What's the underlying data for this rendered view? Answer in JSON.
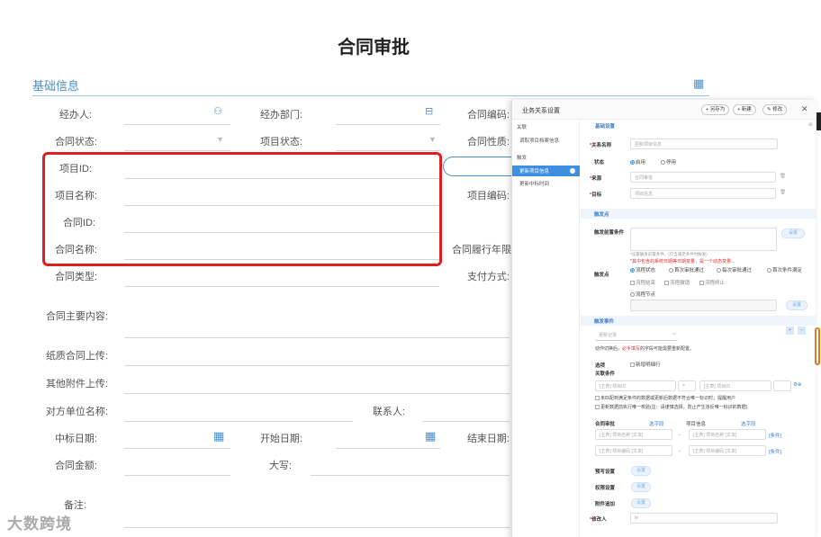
{
  "form": {
    "title": "合同审批",
    "section": "基础信息",
    "labels": {
      "handler": "经办人:",
      "dept": "经办部门:",
      "contract_code": "合同编码:",
      "contract_status": "合同状态:",
      "project_status": "项目状态:",
      "contract_nature": "合同性质:",
      "project_id": "项目ID:",
      "project_name": "项目名称:",
      "project_code": "项目编码:",
      "contract_id": "合同ID:",
      "contract_name": "合同名称:",
      "contract_years": "合同履行年限",
      "contract_type": "合同类型:",
      "payment": "支付方式:",
      "main_content": "合同主要内容:",
      "paper_upload": "纸质合同上传:",
      "other_upload": "其他附件上传:",
      "counterparty": "对方单位名称:",
      "contact": "联系人:",
      "bid_date": "中标日期:",
      "start_date": "开始日期:",
      "end_date": "结束日期:",
      "amount": "合同金额:",
      "capital": "大写:",
      "remark": "备注:"
    }
  },
  "panel": {
    "title": "业务关系设置",
    "buttons": {
      "save_as": "+ 另存为",
      "new": "+ 新建",
      "edit": "✎ 修改"
    },
    "left": {
      "group1": "关联",
      "item1": "调取项目档案信息",
      "group2": "触发",
      "selected": "更新项目信息",
      "item2": "更新中标时间"
    },
    "basic": "基础设置",
    "rel_name_label": "关系名称",
    "rel_name_value": "更新项目信息",
    "status_label": "状态",
    "status_on": "启用",
    "status_off": "停用",
    "source_label": "来源",
    "source_value": "合同审批",
    "target_label": "目标",
    "target_value": "项目信息",
    "trigger_band": "触发点",
    "pre_cond_label": "触发前置条件",
    "set": "设置",
    "hint1": "*设置触发前置条件，(仅当满足条件时触发)",
    "hint2": "*其中包含的系统日期等日期变量，是一个动态变量...",
    "trigger_label": "触发点",
    "opt1": "流程状态",
    "opt2": "首次审批通过",
    "opt3": "每次审批通过",
    "opt4": "首次条件满足",
    "opt5": "流程结束",
    "opt6": "流程撤销",
    "opt7": "流程终止",
    "opt8": "流程节点",
    "event_band": "触发事件",
    "event_select": "更新记录",
    "event_hint_a": "动作切换后，",
    "event_hint_b": "必手填写",
    "event_hint_c": "的字段可能需要重新配置。",
    "option_label": "选项",
    "option_value": "新增明细行",
    "rel_cond_label": "关联条件",
    "cond_left": "[主表] 项目ID",
    "cond_op": "=",
    "cond_right": "[主表] 项目ID",
    "chk1": "未匹配到满足条件的数据或更新后数据不符合唯一标识时，提醒用户",
    "chk2": "更新数据前执行唯一校验(注：请谨慎选择，防止产生违反唯一标识的数据)",
    "map_col1": "合同审批",
    "map_sel1": "选字段",
    "map_col2": "项目信息",
    "map_sel2": "选字段",
    "map1_left": "[主表] 项目名称 [文本]",
    "map1_right": "[主表] 项目名称 [文本]",
    "map2_left": "[主表] 项目编码 [文本]",
    "map2_right": "[主表] 项目编码 [文本]",
    "cond_tag": "[条件]",
    "preset_label": "预写设置",
    "perm_label": "权限设置",
    "attach_label": "附件追加",
    "modifier_label": "修改人",
    "modifier_value": "te"
  },
  "watermark": "大数跨境",
  "colors": {
    "accent": "#3d8fe0",
    "highlight": "#e02020",
    "scroll": "#e07820"
  }
}
